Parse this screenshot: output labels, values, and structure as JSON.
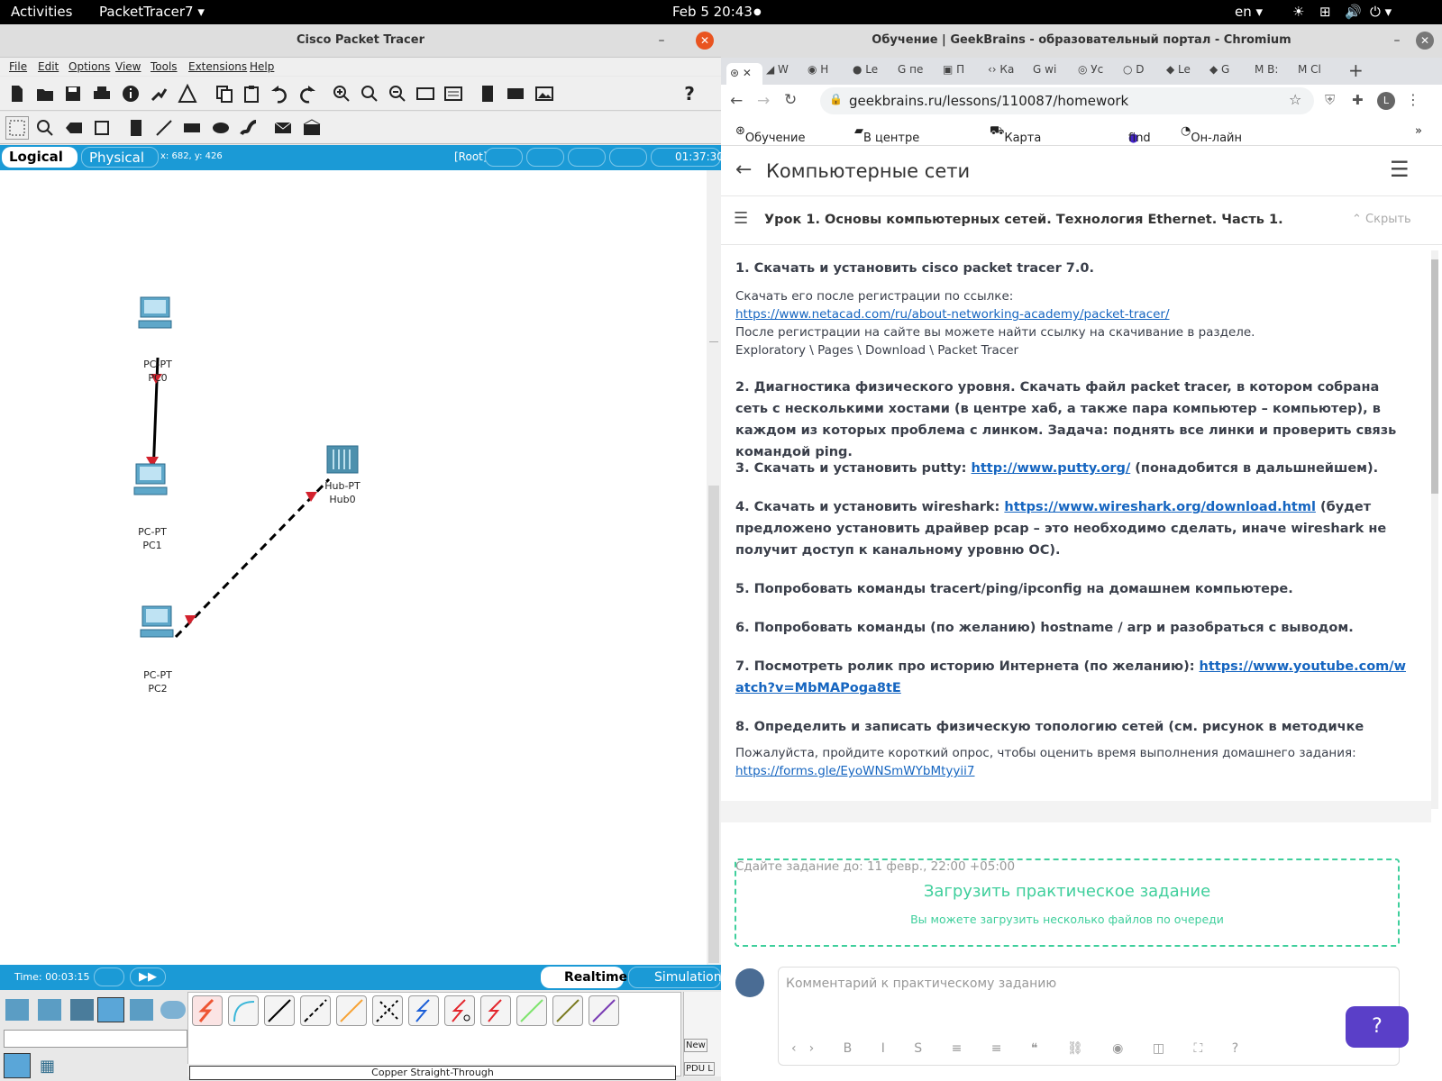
{
  "topbar": {
    "activities": "Activities",
    "app": "PacketTracer7",
    "clock": "Feb 5  20:43",
    "lang": "en"
  },
  "pt": {
    "title": "Cisco Packet Tracer",
    "menu": [
      "File",
      "Edit",
      "Options",
      "View",
      "Tools",
      "Extensions",
      "Help"
    ],
    "tab_logical": "Logical",
    "tab_physical": "Physical",
    "coords": "x: 682, y: 426",
    "root": "[Root]",
    "clock": "01:37:30",
    "devices": [
      {
        "type": "PC-PT",
        "name": "PC0"
      },
      {
        "type": "PC-PT",
        "name": "PC1"
      },
      {
        "type": "Hub-PT",
        "name": "Hub0"
      },
      {
        "type": "PC-PT",
        "name": "PC2"
      }
    ],
    "time_label": "Time: 00:03:15",
    "realtime": "Realtime",
    "simulation": "Simulation",
    "cable_name": "Copper Straight-Through",
    "new_label": "New",
    "pdu_label": "PDU L"
  },
  "chrome": {
    "title": "Обучение | GeekBrains - образовательный портал - Chromium",
    "tabs": [
      "W",
      "H",
      "Le",
      "пе",
      "П",
      "Ка",
      "wi",
      "Уc",
      "D",
      "Le",
      "G",
      "B:",
      "Cl"
    ],
    "url": "geekbrains.ru/lessons/110087/homework",
    "profile": "L",
    "bookmarks": [
      "Обучение | Geek...",
      "В центре вниман...",
      "Карта радаров и...",
      "find",
      "Он-лайн камеры..."
    ]
  },
  "page": {
    "course": "Компьютерные сети",
    "lesson": "Урок 1. Основы компьютерных сетей. Технология Ethernet. Часть 1.",
    "hide": "Скрыть",
    "t1": "1. Скачать и установить cisco packet tracer 7.0.",
    "t1a": "Скачать его после регистрации по ссылке:",
    "t1link": "https://www.netacad.com/ru/about-networking-academy/packet-tracer/",
    "t1b": "После регистрации на сайте вы можете найти ссылку на скачивание в разделе.",
    "t1c": "Exploratory \\ Pages \\ Download \\ Packet Tracer",
    "t2": "2. Диагностика физического уровня. Скачать файл packet tracer, в котором собрана сеть с несколькими хостами (в центре хаб, а также пара компьютер – компьютер), в каждом из которых проблема с линком. Задача: поднять все линки и проверить связь командой ping.",
    "t3a": "3. Скачать и установить putty: ",
    "t3link": "http://www.putty.org/",
    "t3b": " (понадобится в дальшнейшем).",
    "t4a": "4. Скачать и установить wireshark: ",
    "t4link": "https://www.wireshark.org/download.html",
    "t4b": " (будет предложено установить драйвер pcap – это необходимо сделать, иначе wireshark не получит доступ к канальному уровню ОС).",
    "t5": "5. Попробовать команды tracert/ping/ipconfig на домашнем компьютере.",
    "t6": "6. Попробовать команды (по желанию) hostname / arp и разобраться с выводом.",
    "t7a": "7. Посмотреть ролик про историю Интернета (по желанию): ",
    "t7link": "https://www.youtube.com/watch?v=MbMAPoga8tE",
    "t8": "8. Определить и записать физическую топологию сетей (см. рисунок в методичке",
    "survey": "Пожалуйста, пройдите короткий опрос, чтобы оценить время выполнения домашнего задания:",
    "survey_link": "https://forms.gle/EyoWNSmWYbMtyyii7",
    "deadline": "Сдайте задание до: 11 февр., 22:00 +05:00",
    "upload_title": "Загрузить практическое задание",
    "upload_sub": "Вы можете загрузить несколько файлов по очереди",
    "comment_placeholder": "Комментарий к практическому заданию",
    "help": "?"
  }
}
